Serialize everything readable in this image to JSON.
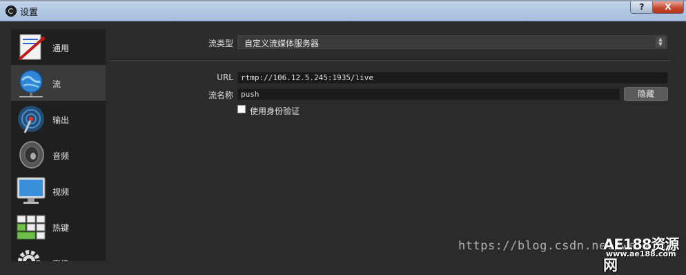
{
  "window": {
    "title": "设置",
    "help_label": "?",
    "close_label": "X"
  },
  "sidebar": {
    "items": [
      {
        "label": "通用",
        "icon": "general-settings-icon"
      },
      {
        "label": "流",
        "icon": "network-globe-icon"
      },
      {
        "label": "输出",
        "icon": "broadcast-antenna-icon"
      },
      {
        "label": "音频",
        "icon": "speaker-icon"
      },
      {
        "label": "视频",
        "icon": "monitor-icon"
      },
      {
        "label": "热键",
        "icon": "keyboard-icon"
      },
      {
        "label": "高级",
        "icon": "gear-icon"
      }
    ],
    "active_index": 1
  },
  "stream": {
    "type_label": "流类型",
    "type_value": "自定义流媒体服务器",
    "url_label": "URL",
    "url_value": "rtmp://106.12.5.245:1935/live",
    "key_label": "流名称",
    "key_value": "push",
    "hide_button": "隐藏",
    "auth_label": "使用身份验证",
    "auth_checked": false
  },
  "overlay": {
    "watermark": "https://blog.csdn.net/weixin_",
    "logo_main": "AE188资源网",
    "logo_sub": "www.ae188.com"
  }
}
